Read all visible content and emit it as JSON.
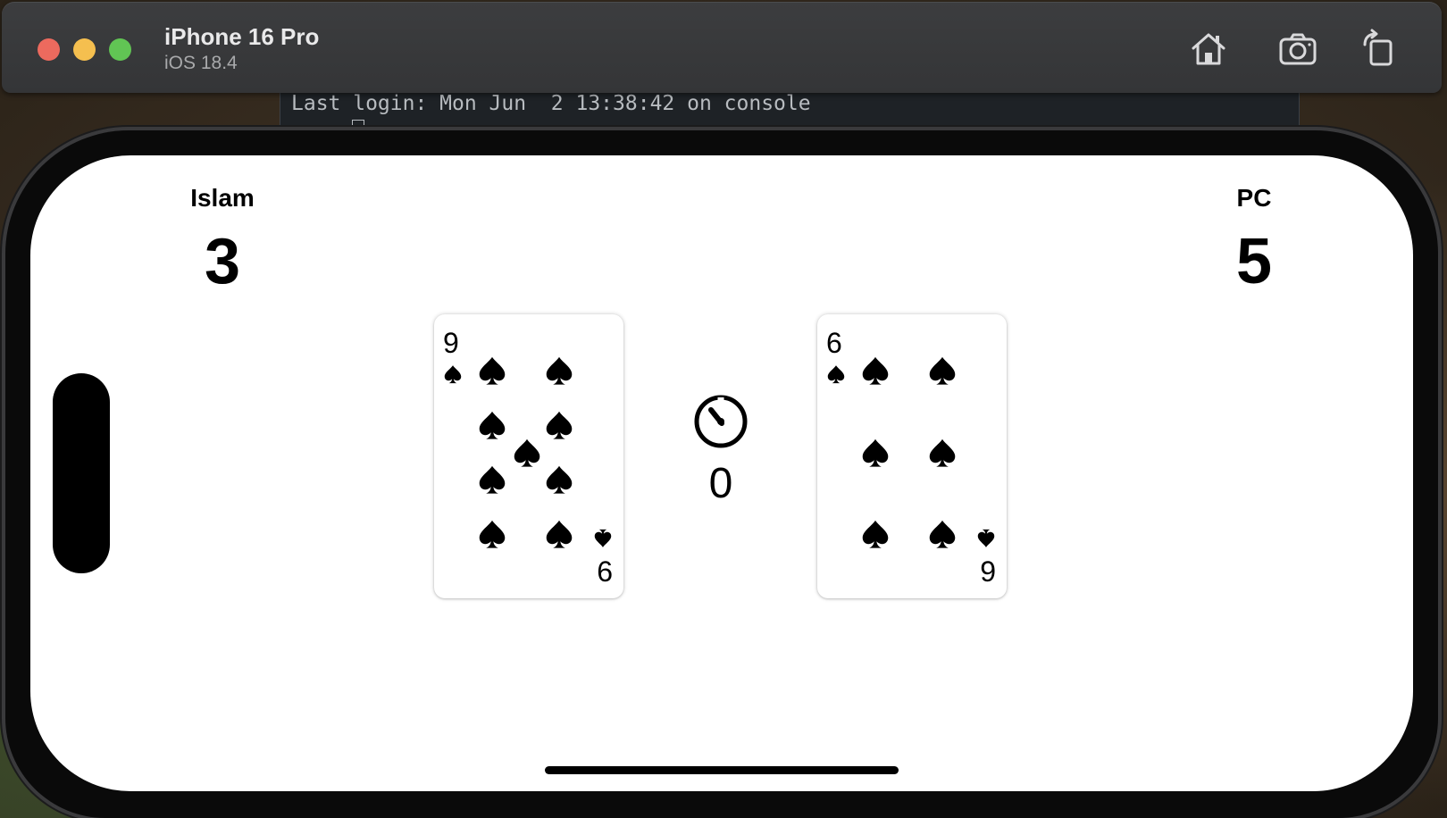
{
  "simulator": {
    "device_name": "iPhone 16 Pro",
    "os_version": "iOS 18.4",
    "buttons": [
      "home-icon",
      "screenshot-camera-icon",
      "rotate-icon"
    ]
  },
  "terminal": {
    "text": "Last login: Mon Jun  2 13:38:42 on console"
  },
  "game": {
    "player": {
      "name": "Islam",
      "score": "3"
    },
    "opponent": {
      "name": "PC",
      "score": "5"
    },
    "timer": {
      "icon": "timer-icon",
      "value": "0"
    },
    "player_card": {
      "top_rank": "9",
      "bottom_rank": "6",
      "suit": "spades",
      "pip_count": 9
    },
    "opponent_card": {
      "top_rank": "6",
      "bottom_rank": "9",
      "suit": "spades",
      "pip_count": 6
    }
  },
  "colors": {
    "traffic_red": "#ed6a5e",
    "traffic_yellow": "#f5bf4f",
    "traffic_green": "#61c554",
    "titlebar": "#3a3b3d"
  }
}
